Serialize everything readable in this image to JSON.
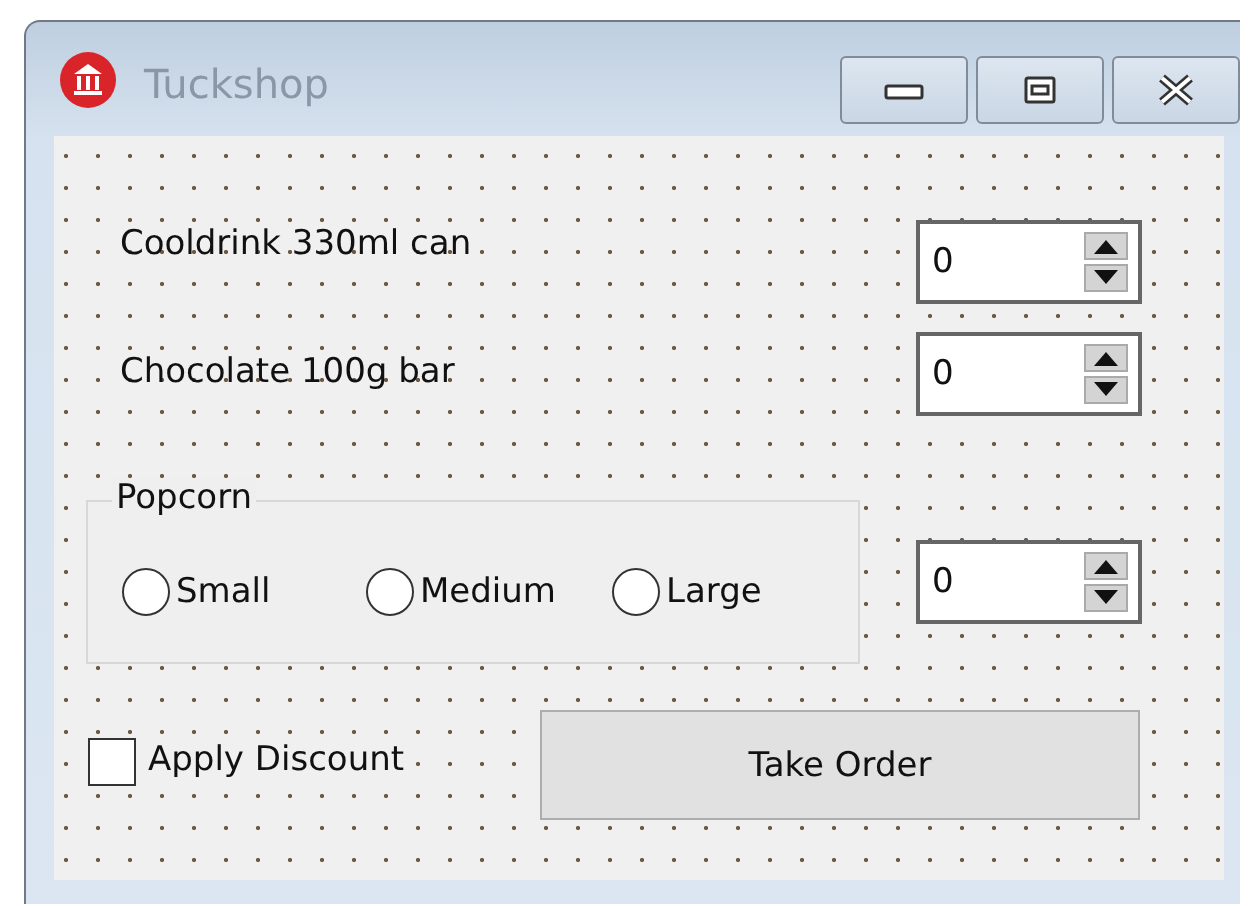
{
  "window": {
    "title": "Tuckshop"
  },
  "items": [
    {
      "label": "Cooldrink 330ml can",
      "value": "0"
    },
    {
      "label": "Chocolate 100g bar",
      "value": "0"
    }
  ],
  "popcorn": {
    "title": "Popcorn",
    "options": [
      {
        "label": "Small",
        "selected": false
      },
      {
        "label": "Medium",
        "selected": false
      },
      {
        "label": "Large",
        "selected": false
      }
    ],
    "value": "0"
  },
  "discount": {
    "label": "Apply Discount",
    "checked": false
  },
  "button": "Take Order"
}
